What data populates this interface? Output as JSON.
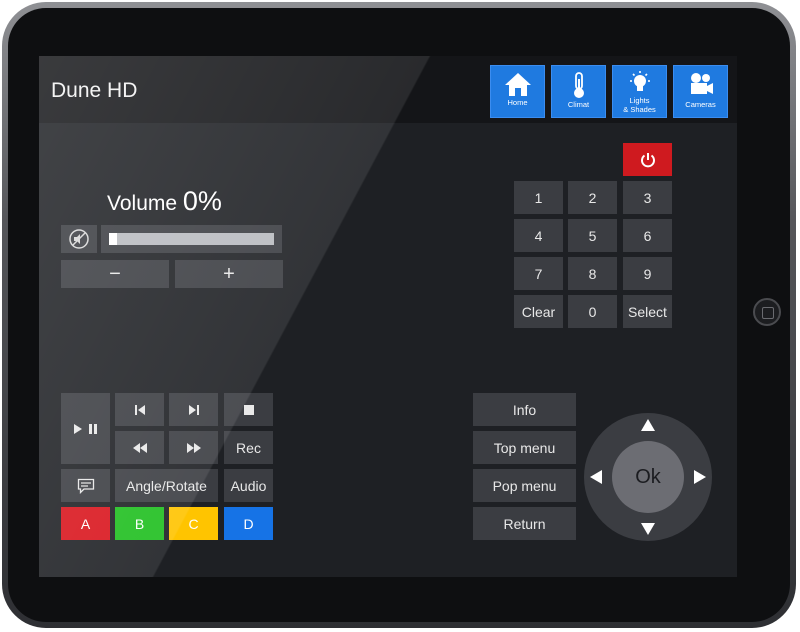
{
  "header": {
    "title": "Dune HD",
    "nav": [
      {
        "label": "Home",
        "icon": "home-icon"
      },
      {
        "label": "Climat",
        "icon": "thermometer-icon"
      },
      {
        "label_line1": "Lights",
        "label_line2": "& Shades",
        "icon": "light-bulb-icon"
      },
      {
        "label": "Cameras",
        "icon": "video-camera-icon"
      }
    ]
  },
  "volume": {
    "label": "Volume",
    "value": "0%",
    "level": 0,
    "minus_label": "−",
    "plus_label": "+"
  },
  "keypad": {
    "keys": [
      "1",
      "2",
      "3",
      "4",
      "5",
      "6",
      "7",
      "8",
      "9",
      "Clear",
      "0",
      "Select"
    ]
  },
  "transport": {
    "rec_label": "Rec",
    "angle_label": "Angle/Rotate",
    "audio_label": "Audio",
    "color_buttons": [
      {
        "label": "A",
        "color": "#d9141c"
      },
      {
        "label": "B",
        "color": "#1fbf1f"
      },
      {
        "label": "C",
        "color": "#ffc400"
      },
      {
        "label": "D",
        "color": "#1673e6"
      }
    ]
  },
  "menu": {
    "info_label": "Info",
    "top_menu_label": "Top menu",
    "pop_menu_label": "Pop menu",
    "return_label": "Return",
    "ok_label": "Ok"
  },
  "colors": {
    "accent_blue": "#1f7ae0",
    "power_red": "#cf1a1f",
    "button_gray": "#3b3d42",
    "screen_bg": "#1e2024"
  }
}
